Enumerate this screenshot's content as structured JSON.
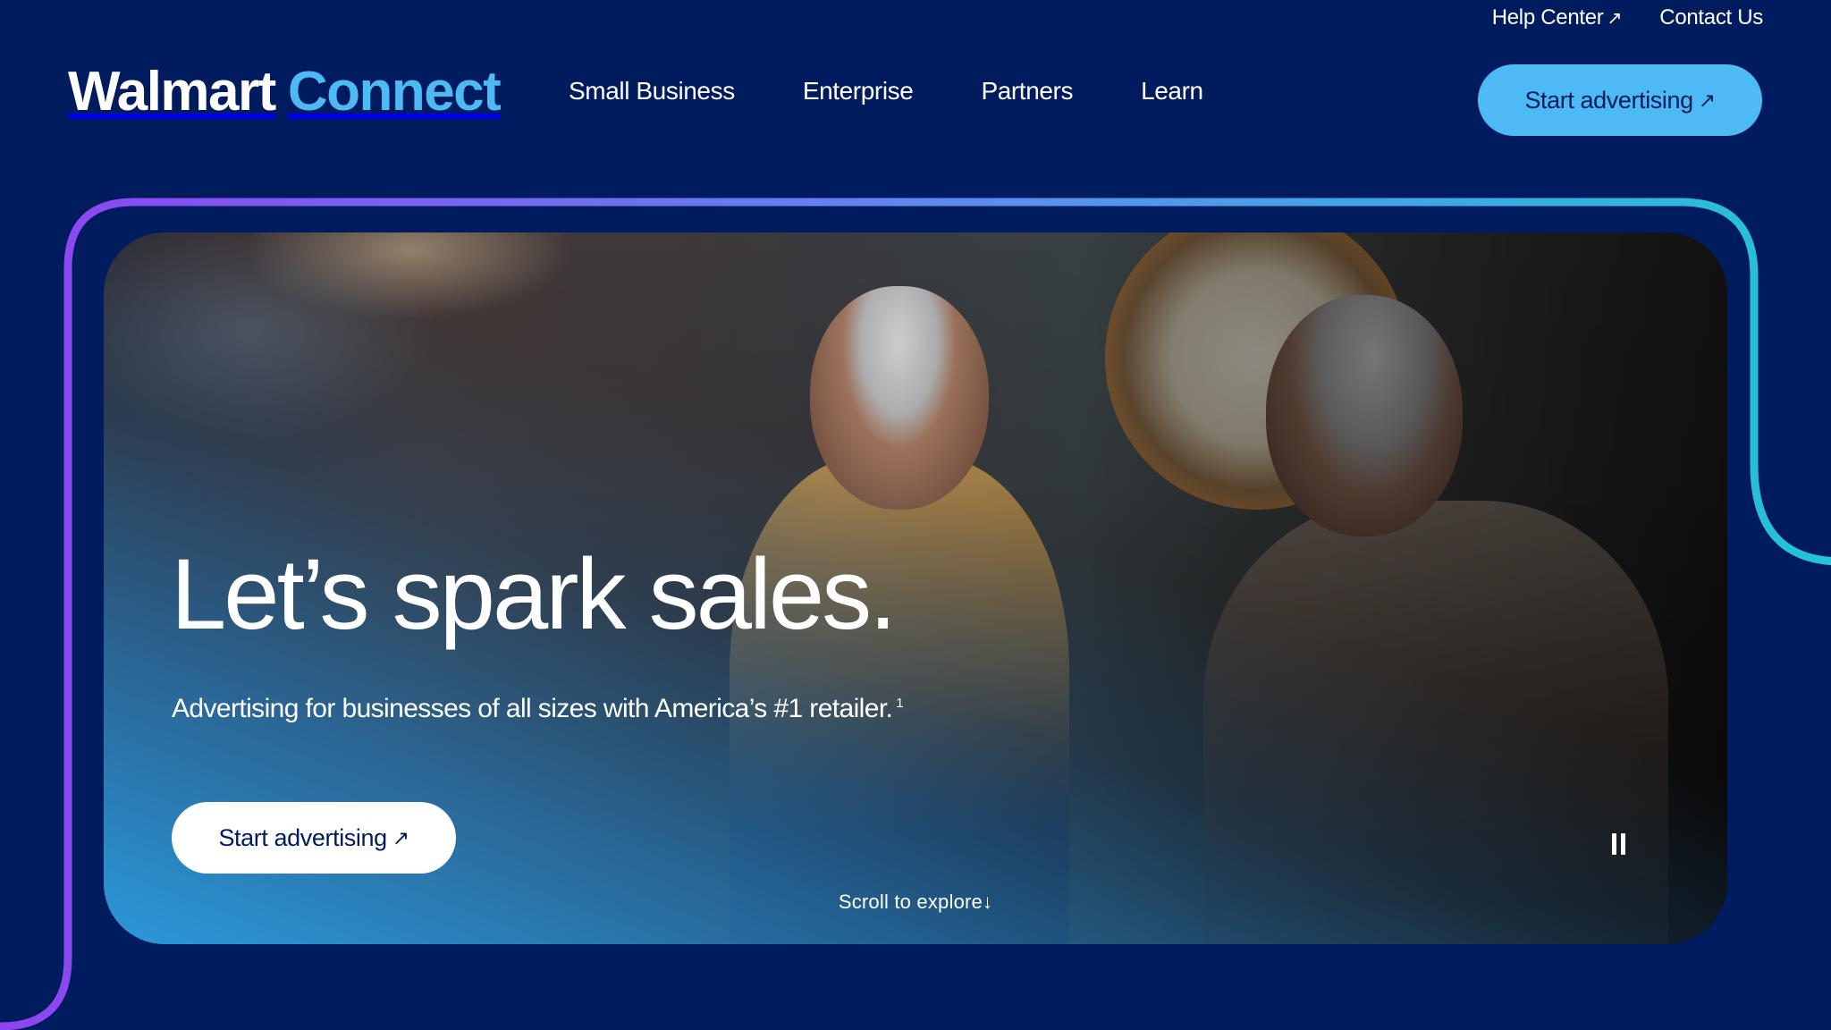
{
  "utility_nav": {
    "help_center": "Help Center",
    "help_center_icon": "external-arrow-icon",
    "contact_us": "Contact Us"
  },
  "brand": {
    "word1": "Walmart",
    "word2": "Connect",
    "colors": {
      "word1": "#ffffff",
      "word2": "#4dbaf5"
    }
  },
  "main_nav": {
    "items": [
      "Small Business",
      "Enterprise",
      "Partners",
      "Learn"
    ]
  },
  "header_cta": {
    "label": "Start advertising",
    "icon": "external-arrow-icon",
    "bg": "#4dbaf5"
  },
  "hero": {
    "headline": "Let’s spark sales.",
    "subheadline": "Advertising for businesses of all sizes with America’s #1 retailer.",
    "footnote_marker": "1",
    "cta_label": "Start advertising",
    "scroll_hint": "Scroll to explore",
    "scroll_icon": "arrow-down-icon",
    "media_control_icon": "pause-icon"
  },
  "arrow_glyph": "↗",
  "down_glyph": "↓",
  "colors": {
    "page_bg": "#001b5e",
    "frame_gradient": [
      "#8e44f0",
      "#5b8ef0",
      "#22c4d8"
    ]
  }
}
